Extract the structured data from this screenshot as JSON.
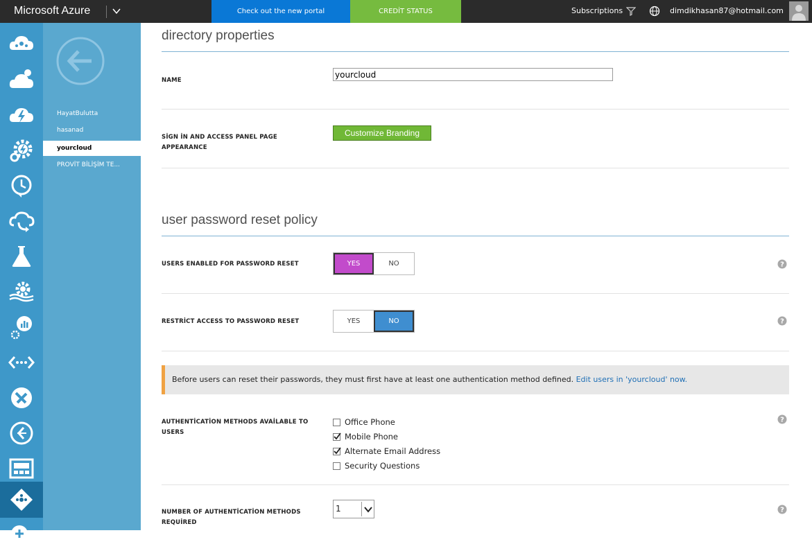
{
  "topbar": {
    "brand": "Microsoft Azure",
    "portal_button": "Check out the new portal",
    "credit_button": "CREDİT STATUS",
    "subscriptions": "Subscriptions",
    "email": "dimdikhasan87@hotmail.com"
  },
  "colors": {
    "topbar": "#2b2b2b",
    "portal": "#0a78d6",
    "credit": "#76bb3f",
    "rail": "#3e98c9",
    "subnav": "#5aa8cf",
    "yes_active": "#c24bcb",
    "no_active": "#3f8ed0",
    "notice_accent": "#f0a243"
  },
  "rail": {
    "icons": [
      "cloud-network-icon",
      "cloud-services-icon",
      "cloud-lightning-icon",
      "gear-lightning-icon",
      "clock-icon",
      "cloud-sync-icon",
      "flask-icon",
      "gears-icon",
      "analytics-icon",
      "code-arrows-icon",
      "tools-icon",
      "remote-icon",
      "media-icon",
      "directory-icon",
      "add-icon"
    ]
  },
  "subnav": {
    "items": [
      "HayatBulutta",
      "hasanad",
      "yourcloud",
      "PROVİT BİLİŞİM TE..."
    ],
    "selected": "yourcloud"
  },
  "directory_properties": {
    "title": "directory properties",
    "name_label": "NAME",
    "name_value": "yourcloud",
    "signin_label": "SİGN İN AND ACCESS PANEL PAGE APPEARANCE",
    "customize_button": "Customize Branding"
  },
  "password_reset": {
    "title": "user password reset policy",
    "users_enabled_label": "USERS ENABLED FOR PASSWORD RESET",
    "restrict_label": "RESTRİCT ACCESS TO PASSWORD RESET",
    "yes": "YES",
    "no": "NO",
    "users_enabled_value": "YES",
    "restrict_value": "NO",
    "notice_text": "Before users can reset their passwords, they must first have at least one authentication method defined.",
    "notice_link": "Edit users in 'yourcloud' now.",
    "auth_methods_label": "AUTHENTİCATİON METHODS AVAİLABLE TO USERS",
    "auth_methods": [
      {
        "label": "Office Phone",
        "checked": false
      },
      {
        "label": "Mobile Phone",
        "checked": true
      },
      {
        "label": "Alternate Email Address",
        "checked": true
      },
      {
        "label": "Security Questions",
        "checked": false
      }
    ],
    "num_methods_label": "NUMBER OF AUTHENTİCATİON METHODS REQUİRED",
    "num_methods_value": "1"
  }
}
